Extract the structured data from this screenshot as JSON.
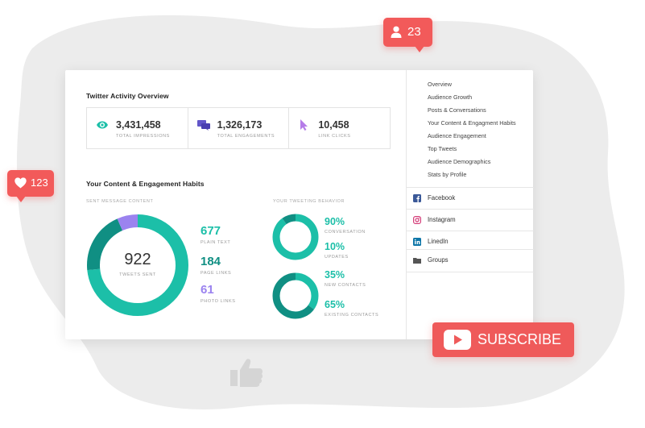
{
  "overview": {
    "title": "Twitter Activity Overview",
    "stats": [
      {
        "value": "3,431,458",
        "label": "TOTAL IMPRESSIONS",
        "icon": "eye-icon",
        "color": "#1cbfa8"
      },
      {
        "value": "1,326,173",
        "label": "TOTAL ENGAGEMENTS",
        "icon": "chat-bubbles-icon",
        "color": "#6256c9"
      },
      {
        "value": "10,458",
        "label": "LINK CLICKS",
        "icon": "cursor-icon",
        "color": "#b57ce8"
      }
    ]
  },
  "habits": {
    "title": "Your Content & Engagement Habits",
    "sent_label": "SENT MESSAGE CONTENT",
    "total_value": "922",
    "total_label": "TWEETS SENT",
    "breakdown": [
      {
        "value": "677",
        "label": "PLAIN TEXT",
        "color": "#1cbfa8"
      },
      {
        "value": "184",
        "label": "PAGE LINKS",
        "color": "#108f83"
      },
      {
        "value": "61",
        "label": "PHOTO LINKS",
        "color": "#9b83ef"
      }
    ],
    "behavior_label": "YOUR TWEETING BEHAVIOR",
    "behavior": [
      {
        "value": "90%",
        "label": "CONVERSATION"
      },
      {
        "value": "10%",
        "label": "UPDATES"
      },
      {
        "value": "35%",
        "label": "NEW CONTACTS"
      },
      {
        "value": "65%",
        "label": "EXISTING CONTACTS"
      }
    ]
  },
  "sidebar": {
    "items": [
      {
        "label": "Overview"
      },
      {
        "label": "Audience Growth"
      },
      {
        "label": "Posts & Conversations"
      },
      {
        "label": "Your Content & Engagment Habits"
      },
      {
        "label": "Audience Engagement"
      },
      {
        "label": "Top Tweets"
      },
      {
        "label": "Audience Demographics"
      },
      {
        "label": "Stats by Profile"
      }
    ],
    "socials": [
      {
        "label": "Facebook",
        "icon": "facebook-icon",
        "color": "#3b5998"
      },
      {
        "label": "Instagram",
        "icon": "instagram-icon",
        "color": "#d43c78"
      },
      {
        "label": "LinedIn",
        "icon": "linkedin-icon",
        "color": "#0e76a8"
      },
      {
        "label": "Groups",
        "icon": "folder-icon",
        "color": "#555555"
      }
    ]
  },
  "badges": {
    "followers": "23",
    "likes": "123",
    "subscribe": "SUBSCRIBE"
  },
  "colors": {
    "teal": "#1cbfa8",
    "dark_teal": "#108f83",
    "purple": "#9b83ef",
    "badge_red": "#f25a5a"
  }
}
